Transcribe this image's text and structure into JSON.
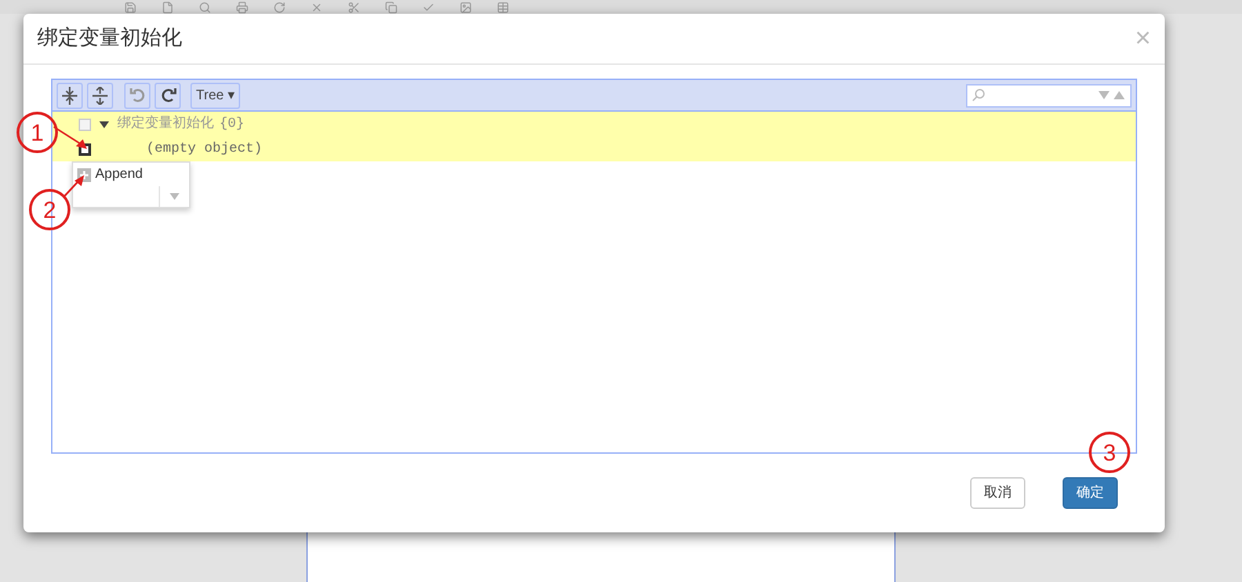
{
  "dialog": {
    "title": "绑定变量初始化",
    "close": "×"
  },
  "editor": {
    "toolbar": {
      "mode": "Tree ▾"
    },
    "rows": [
      {
        "kind": "root",
        "key": "绑定变量初始化",
        "count": "{0}",
        "expanded": true
      },
      {
        "kind": "empty",
        "text": "(empty object)"
      }
    ],
    "context_menu": {
      "items": [
        {
          "kind": "action",
          "label": "Append"
        },
        {
          "kind": "submenu"
        }
      ]
    }
  },
  "annotations": [
    {
      "label": "1"
    },
    {
      "label": "2"
    },
    {
      "label": "3"
    }
  ],
  "buttons": [
    {
      "label": "取消",
      "kind": "default"
    },
    {
      "label": "确定",
      "kind": "primary"
    }
  ]
}
